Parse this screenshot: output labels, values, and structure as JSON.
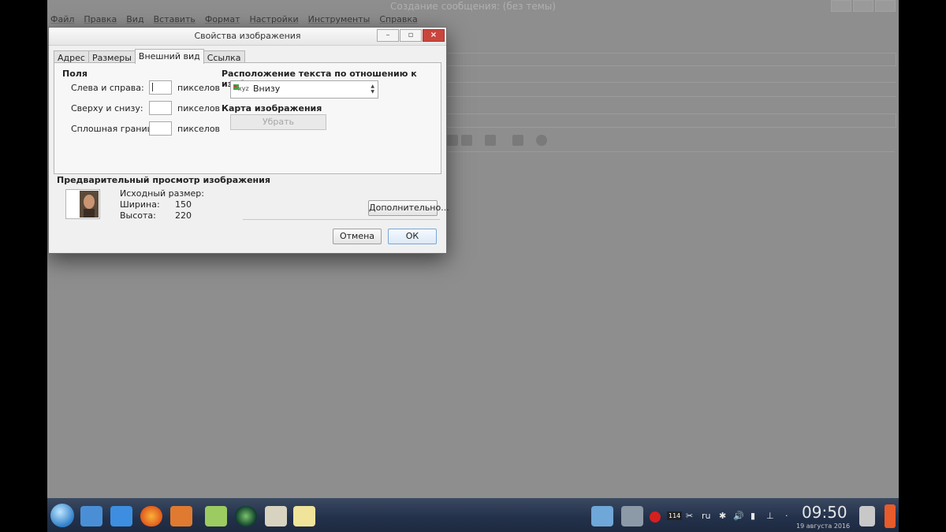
{
  "background_app": {
    "title": "Создание сообщения: (без темы)",
    "menu": [
      "Файл",
      "Правка",
      "Вид",
      "Вставить",
      "Формат",
      "Настройки",
      "Инструменты",
      "Справка"
    ]
  },
  "dialog": {
    "title": "Свойства изображения",
    "tabs": [
      "Адрес",
      "Размеры",
      "Внешний вид",
      "Ссылка"
    ],
    "active_tab": "Внешний вид",
    "fields_section": "Поля",
    "fields": [
      {
        "label": "Слева и справа:",
        "value": "",
        "unit": "пикселов"
      },
      {
        "label": "Сверху и снизу:",
        "value": "",
        "unit": "пикселов"
      },
      {
        "label": "Сплошная граница:",
        "value": "",
        "unit": "пикселов"
      }
    ],
    "text_position_label": "Расположение текста по отношению к изображению",
    "text_position_icon_text": "xyz",
    "text_position_value": "Внизу",
    "image_map_label": "Карта изображения",
    "remove_button": "Убрать",
    "preview_label": "Предварительный просмотр изображения",
    "original_size_label": "Исходный размер:",
    "width_label": "Ширина:",
    "width_value": "150",
    "height_label": "Высота:",
    "height_value": "220",
    "advanced_button": "Дополнительно...",
    "cancel_button": "Отмена",
    "ok_button": "ОК"
  },
  "taskbar": {
    "keyboard_layout": "ru",
    "badge": "114",
    "clock": "09:50",
    "date": "19 августа 2016"
  },
  "colors": {
    "dim_background": "#8e8e8e",
    "dialog_bg": "#f0f0f0",
    "close_button": "#c9463d",
    "taskbar": "#22304a"
  }
}
